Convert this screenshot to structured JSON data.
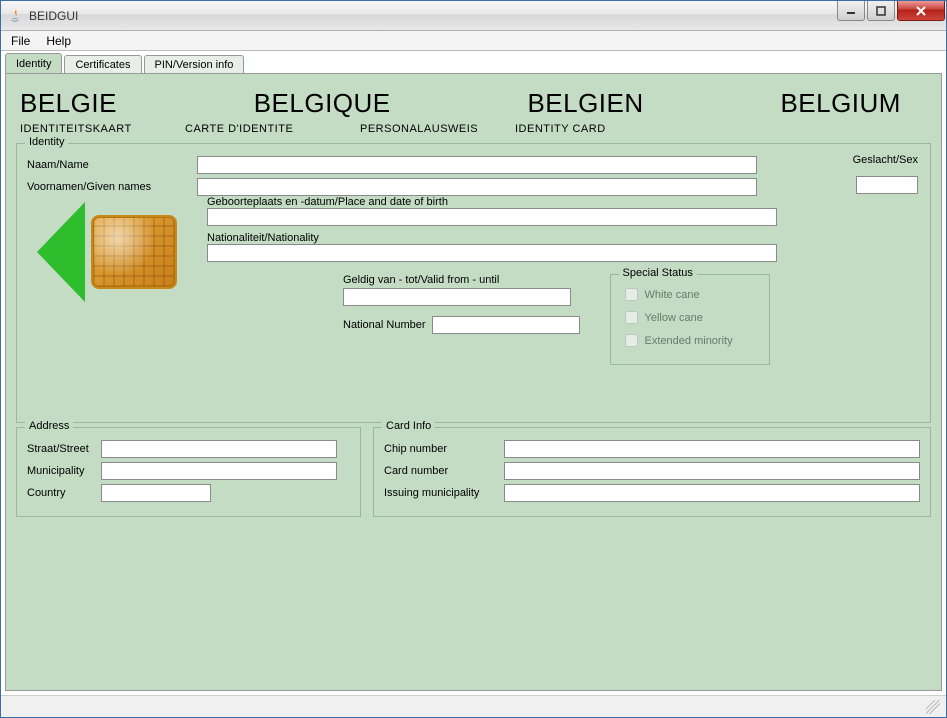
{
  "window": {
    "title": "BEIDGUI"
  },
  "menu": {
    "file": "File",
    "help": "Help"
  },
  "tabs": [
    {
      "label": "Identity",
      "active": true
    },
    {
      "label": "Certificates",
      "active": false
    },
    {
      "label": "PIN/Version info",
      "active": false
    }
  ],
  "countries": {
    "nl": "BELGIE",
    "fr": "BELGIQUE",
    "de": "BELGIEN",
    "en": "BELGIUM"
  },
  "subheads": {
    "nl": "IDENTITEITSKAART",
    "fr": "CARTE D'IDENTITE",
    "de": "PERSONALAUSWEIS",
    "en": "IDENTITY CARD"
  },
  "identity": {
    "legend": "Identity",
    "name_label": "Naam/Name",
    "name_value": "",
    "given_label": "Voornamen/Given names",
    "given_value": "",
    "sex_label": "Geslacht/Sex",
    "sex_value": "",
    "birth_label": "Geboorteplaats en -datum/Place and date of birth",
    "birth_value": "",
    "nationality_label": "Nationaliteit/Nationality",
    "nationality_value": "",
    "valid_label": "Geldig van - tot/Valid from - until",
    "valid_value": "",
    "nn_label": "National Number",
    "nn_value": ""
  },
  "special": {
    "legend": "Special Status",
    "white_cane": "White cane",
    "yellow_cane": "Yellow cane",
    "extended_minority": "Extended minority"
  },
  "address": {
    "legend": "Address",
    "street_label": "Straat/Street",
    "street_value": "",
    "municipality_label": "Municipality",
    "municipality_value": "",
    "country_label": "Country",
    "country_value": ""
  },
  "card": {
    "legend": "Card Info",
    "chip_label": "Chip number",
    "chip_value": "",
    "cardnum_label": "Card number",
    "cardnum_value": "",
    "issuing_label": "Issuing municipality",
    "issuing_value": ""
  }
}
